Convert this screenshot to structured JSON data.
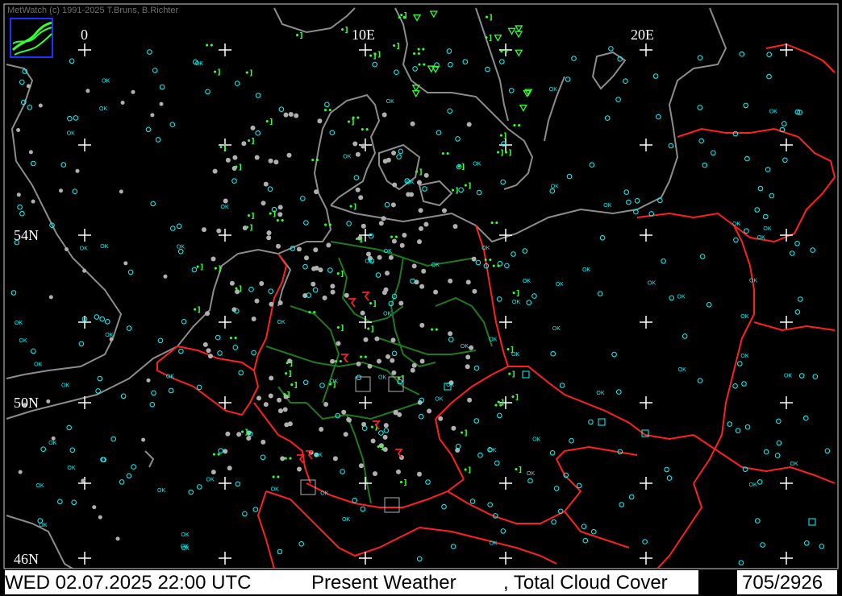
{
  "header": {
    "copyright": "MetWatch  (c) 1991-2025 T.Bruns, B.Richter"
  },
  "grid_labels": {
    "lon": [
      "0",
      "10E",
      "20E"
    ],
    "lat": [
      "54N",
      "50N",
      "46N"
    ]
  },
  "status": {
    "datetime": "WED 02.07.2025 22:00 UTC",
    "product": "Present Weather",
    "overlay": ", Total Cloud Cover",
    "count": "705/2926"
  },
  "colors": {
    "background": "#000000",
    "coastline": "#8c8c8c",
    "borders": "#ff2020",
    "german_states": "#1f7a1f",
    "cloud_symbols": "#00ffff",
    "weather_symbols": "#33ff33",
    "thunder_symbols": "#ff2020",
    "station_dots": "#b0b0b0",
    "grid_crosses": "#ffffff"
  },
  "symbols": {
    "clear_sky_text": "OK",
    "drizzle_text": "••",
    "shower_text": "•]"
  }
}
